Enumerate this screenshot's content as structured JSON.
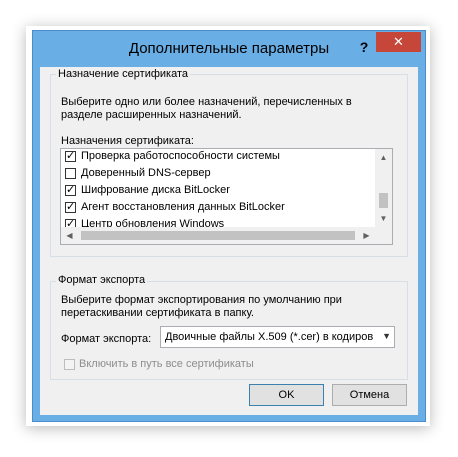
{
  "window": {
    "title": "Дополнительные параметры",
    "help_label": "?",
    "close_label": "✕"
  },
  "purpose_group": {
    "label": "Назначение сертификата",
    "description_line1": "Выберите одно или более назначений, перечисленных в",
    "description_line2": "разделе расширенных назначений.",
    "list_label": "Назначения сертификата:",
    "items": [
      {
        "label": "Проверка работоспособности системы",
        "checked": true
      },
      {
        "label": "Доверенный DNS-сервер",
        "checked": false
      },
      {
        "label": "Шифрование диска BitLocker",
        "checked": true
      },
      {
        "label": "Агент восстановления данных BitLocker",
        "checked": true
      },
      {
        "label": "Центр обновления Windows",
        "checked": true
      }
    ],
    "scroll_up_icon": "chevron-up-icon",
    "scroll_down_icon": "chevron-down-icon",
    "scroll_left_icon": "chevron-left-icon",
    "scroll_right_icon": "chevron-right-icon"
  },
  "export_group": {
    "label": "Формат экспорта",
    "description_line1": "Выберите формат экспортирования по умолчанию при",
    "description_line2": "перетаскивании сертификата в папку.",
    "format_label": "Формат экспорта:",
    "format_value": "Двоичные файлы X.509 (*.cer) в кодиров",
    "include_path_label": "Включить в путь все сертификаты",
    "include_path_checked": false
  },
  "buttons": {
    "ok_label": "OK",
    "cancel_label": "Отмена"
  },
  "colors": {
    "title_bar": "#6aaee6",
    "close_button": "#c7463a",
    "client_background": "#f0f0f0"
  }
}
